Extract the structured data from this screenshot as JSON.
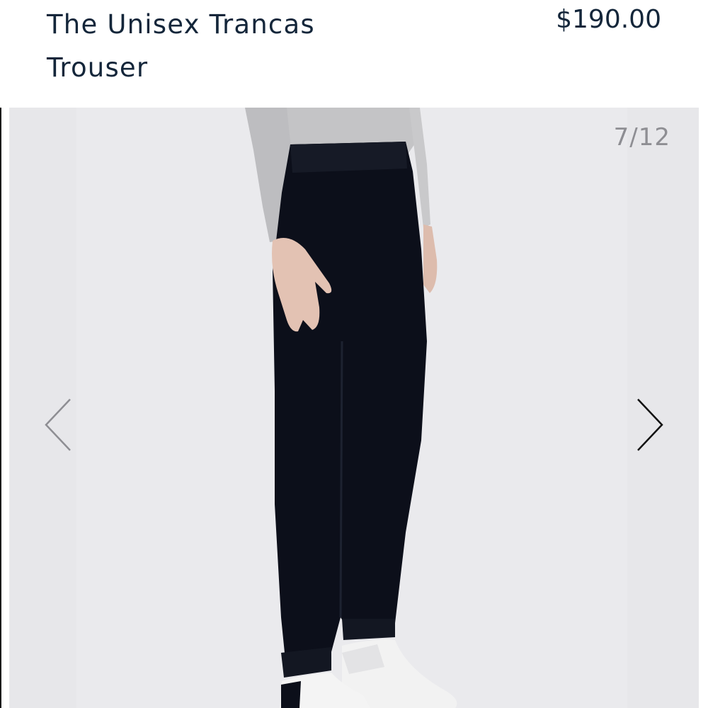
{
  "product": {
    "title": "The Unisex Trancas Trouser",
    "price": "$190.00"
  },
  "gallery": {
    "counter": "7/12",
    "current_index": 7,
    "total": 12,
    "prev_icon": "chevron-left-icon",
    "next_icon": "chevron-right-icon"
  },
  "colors": {
    "title_text": "#14263a",
    "gallery_bg": "#e7e7ea",
    "counter_text": "#8e8e93",
    "trouser": "#0c0f1a",
    "sweater": "#c4c4c6"
  }
}
